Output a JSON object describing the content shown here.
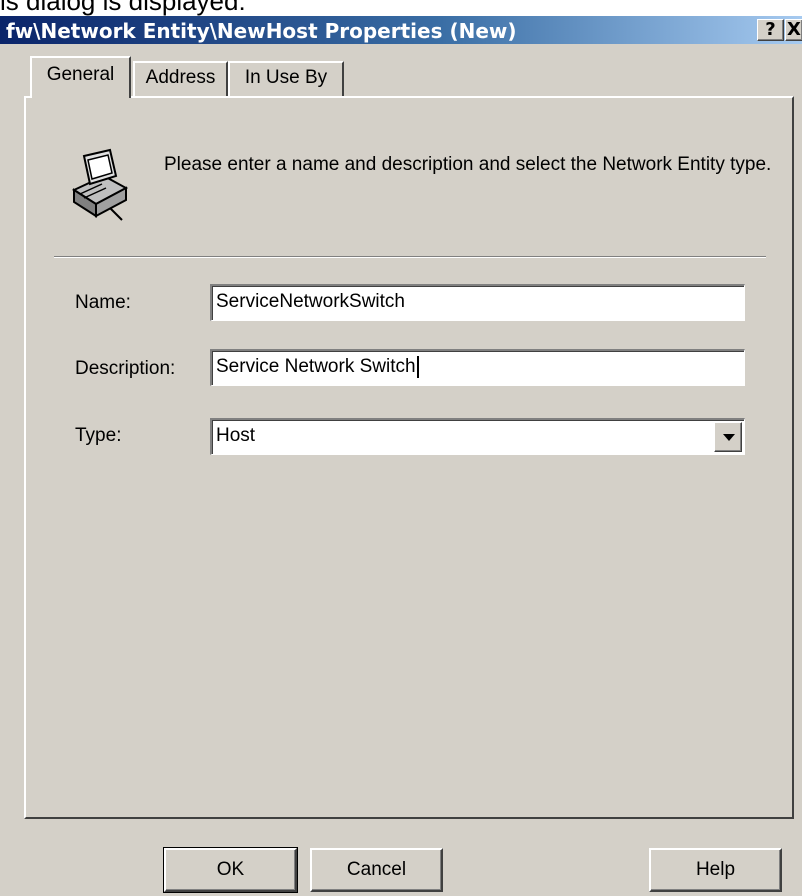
{
  "caption_fragment": "is dialog is displayed:",
  "window": {
    "title": "fw\\Network Entity\\NewHost Properties (New)",
    "help_glyph": "?",
    "close_glyph": "X"
  },
  "tabs": [
    {
      "label": "General",
      "active": true
    },
    {
      "label": "Address",
      "active": false
    },
    {
      "label": "In Use By",
      "active": false
    }
  ],
  "general": {
    "icon": "network-entity-icon",
    "intro": "Please enter a name and description and select the Network Entity type.",
    "name_label": "Name:",
    "name_value": "ServiceNetworkSwitch",
    "description_label": "Description:",
    "description_value": "Service Network Switch",
    "type_label": "Type:",
    "type_value": "Host"
  },
  "buttons": {
    "ok": "OK",
    "cancel": "Cancel",
    "help": "Help"
  },
  "colors": {
    "face": "#d4d0c8",
    "titlebar_start": "#0a246a",
    "titlebar_end": "#a6caf0"
  }
}
